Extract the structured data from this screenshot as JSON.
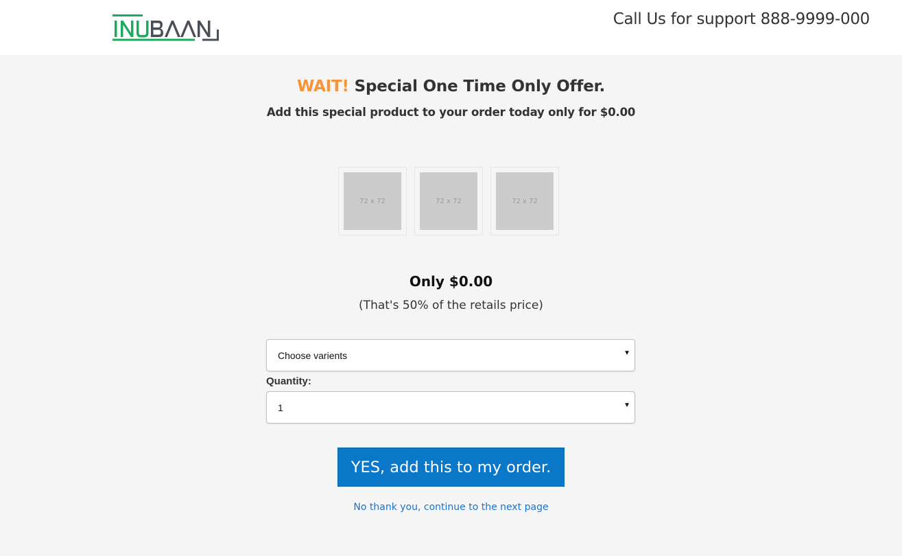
{
  "header": {
    "logo_text": "INUBAAN",
    "support_text": "Call Us for support 888-9999-000"
  },
  "offer": {
    "wait_text": "WAIT!",
    "headline_text": "Special One Time Only Offer.",
    "subheadline": "Add this special product to your order today only for $0.00"
  },
  "thumbnails": [
    {
      "label": "72 x 72"
    },
    {
      "label": "72 x 72"
    },
    {
      "label": "72 x 72"
    }
  ],
  "pricing": {
    "price_text": "Only $0.00",
    "note": "(That's 50% of the retails price)"
  },
  "form": {
    "variant_selected": "Choose varients",
    "quantity_label": "Quantity:",
    "quantity_selected": "1"
  },
  "actions": {
    "yes_label": "YES, add this to my order.",
    "no_label": "No thank you, continue to the next page"
  },
  "colors": {
    "accent_orange": "#f7943a",
    "button_blue": "#0a77c9",
    "link_blue": "#1a73d0",
    "logo_green": "#1bab5e",
    "logo_gray": "#4a4f55"
  }
}
